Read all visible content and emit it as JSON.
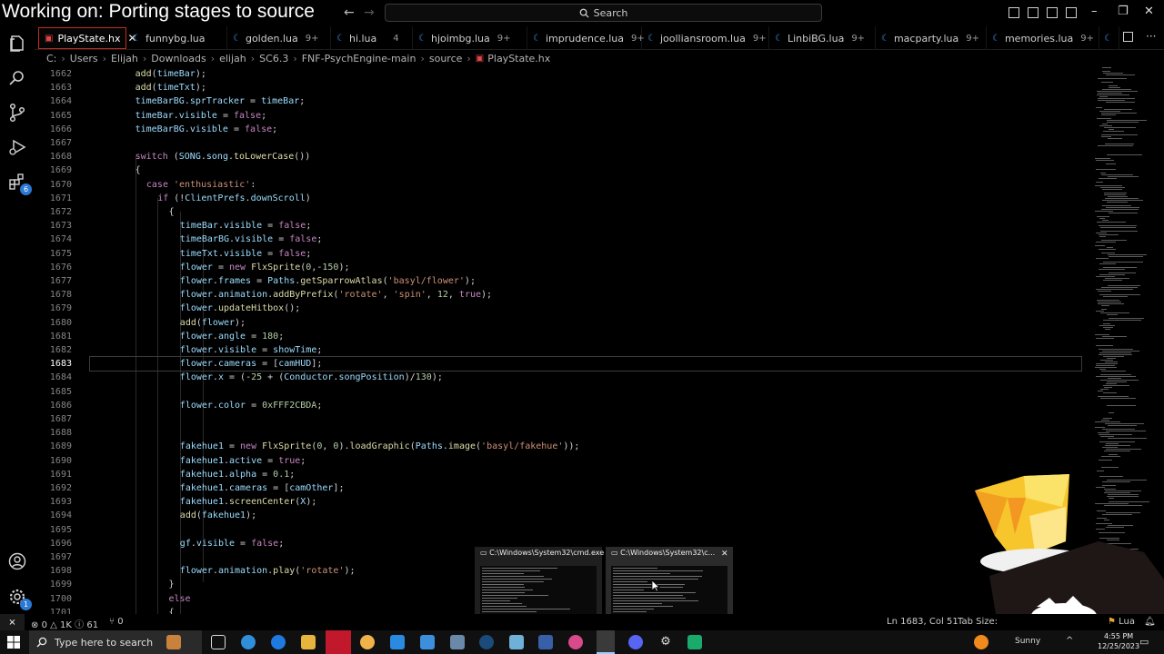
{
  "overlay_title": "Working on: Porting stages to source",
  "search": {
    "label": "Search"
  },
  "tabs": [
    {
      "label": "PlayState.hx",
      "icon": "haxe",
      "problems": "",
      "active": true
    },
    {
      "label": "funnybg.lua",
      "icon": "lua",
      "problems": ""
    },
    {
      "label": "golden.lua",
      "icon": "lua",
      "problems": "9+"
    },
    {
      "label": "hi.lua",
      "icon": "lua",
      "problems": "4"
    },
    {
      "label": "hjoimbg.lua",
      "icon": "lua",
      "problems": "9+"
    },
    {
      "label": "imprudence.lua",
      "icon": "lua",
      "problems": "9+"
    },
    {
      "label": "joolliansroom.lua",
      "icon": "lua",
      "problems": "9+"
    },
    {
      "label": "LinbiBG.lua",
      "icon": "lua",
      "problems": "9+"
    },
    {
      "label": "macparty.lua",
      "icon": "lua",
      "problems": "9+"
    },
    {
      "label": "memories.lua",
      "icon": "lua",
      "problems": "9+"
    }
  ],
  "breadcrumb": [
    "C:",
    "Users",
    "Elijah",
    "Downloads",
    "elijah",
    "SC6.3",
    "FNF-PsychEngine-main",
    "source",
    "PlayState.hx"
  ],
  "code": {
    "current_line": 1683,
    "lines": [
      {
        "n": 1662,
        "indent": 2,
        "text": "add(timeBar);"
      },
      {
        "n": 1663,
        "indent": 2,
        "text": "add(timeTxt);"
      },
      {
        "n": 1664,
        "indent": 2,
        "text": "timeBarBG.sprTracker = timeBar;"
      },
      {
        "n": 1665,
        "indent": 2,
        "text": "timeBar.visible = false;"
      },
      {
        "n": 1666,
        "indent": 2,
        "text": "timeBarBG.visible = false;"
      },
      {
        "n": 1667,
        "indent": 2,
        "text": ""
      },
      {
        "n": 1668,
        "indent": 2,
        "text": "switch (SONG.song.toLowerCase())"
      },
      {
        "n": 1669,
        "indent": 2,
        "text": "{"
      },
      {
        "n": 1670,
        "indent": 3,
        "text": "case 'enthusiastic':"
      },
      {
        "n": 1671,
        "indent": 4,
        "text": "if (!ClientPrefs.downScroll)"
      },
      {
        "n": 1672,
        "indent": 5,
        "text": "{"
      },
      {
        "n": 1673,
        "indent": 6,
        "text": "timeBar.visible = false;"
      },
      {
        "n": 1674,
        "indent": 6,
        "text": "timeBarBG.visible = false;"
      },
      {
        "n": 1675,
        "indent": 6,
        "text": "timeTxt.visible = false;"
      },
      {
        "n": 1676,
        "indent": 6,
        "text": "flower = new FlxSprite(0,-150);"
      },
      {
        "n": 1677,
        "indent": 6,
        "text": "flower.frames = Paths.getSparrowAtlas('basyl/flower');"
      },
      {
        "n": 1678,
        "indent": 6,
        "text": "flower.animation.addByPrefix('rotate', 'spin', 12, true);"
      },
      {
        "n": 1679,
        "indent": 6,
        "text": "flower.updateHitbox();"
      },
      {
        "n": 1680,
        "indent": 6,
        "text": "add(flower);"
      },
      {
        "n": 1681,
        "indent": 6,
        "text": "flower.angle = 180;"
      },
      {
        "n": 1682,
        "indent": 6,
        "text": "flower.visible = showTime;"
      },
      {
        "n": 1683,
        "indent": 6,
        "text": "flower.cameras = [camHUD];"
      },
      {
        "n": 1684,
        "indent": 6,
        "text": "flower.x = (-25 + (Conductor.songPosition)/130);"
      },
      {
        "n": 1685,
        "indent": 6,
        "text": ""
      },
      {
        "n": 1686,
        "indent": 6,
        "text": "flower.color = 0xFFF2CBDA;"
      },
      {
        "n": 1687,
        "indent": 6,
        "text": ""
      },
      {
        "n": 1688,
        "indent": 6,
        "text": ""
      },
      {
        "n": 1689,
        "indent": 6,
        "text": "fakehue1 = new FlxSprite(0, 0).loadGraphic(Paths.image('basyl/fakehue'));"
      },
      {
        "n": 1690,
        "indent": 6,
        "text": "fakehue1.active = true;"
      },
      {
        "n": 1691,
        "indent": 6,
        "text": "fakehue1.alpha = 0.1;"
      },
      {
        "n": 1692,
        "indent": 6,
        "text": "fakehue1.cameras = [camOther];"
      },
      {
        "n": 1693,
        "indent": 6,
        "text": "fakehue1.screenCenter(X);"
      },
      {
        "n": 1694,
        "indent": 6,
        "text": "add(fakehue1);"
      },
      {
        "n": 1695,
        "indent": 6,
        "text": ""
      },
      {
        "n": 1696,
        "indent": 6,
        "text": "gf.visible = false;"
      },
      {
        "n": 1697,
        "indent": 6,
        "text": ""
      },
      {
        "n": 1698,
        "indent": 6,
        "text": "flower.animation.play('rotate');"
      },
      {
        "n": 1699,
        "indent": 5,
        "text": "}"
      },
      {
        "n": 1700,
        "indent": 5,
        "text": "else"
      },
      {
        "n": 1701,
        "indent": 5,
        "text": "{"
      }
    ]
  },
  "status": {
    "errors": "0",
    "warnings": "1K",
    "info": "61",
    "ports": "0",
    "cursor": "Ln 1683, Col 51",
    "tab_size": "Tab Size:",
    "language": "Lua"
  },
  "previews": [
    {
      "title": "C:\\Windows\\System32\\cmd.exe"
    },
    {
      "title": "C:\\Windows\\System32\\c..."
    }
  ],
  "taskbar": {
    "search_placeholder": "Type here to search",
    "weather": "Sunny",
    "time": "4:55 PM",
    "date": "12/25/2023"
  },
  "colors": {
    "accent": "#c42b1c",
    "keyword": "#c586c0",
    "string": "#ce9178",
    "number": "#b5cea8",
    "function": "#dcdcaa",
    "property": "#9cdcfe",
    "badge": "#2c79d4"
  }
}
